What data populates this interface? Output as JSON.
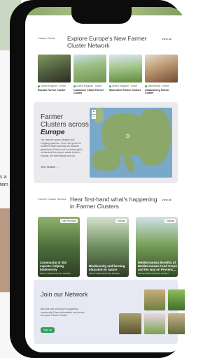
{
  "background_page": {
    "text_lines": [
      "s a",
      "tem"
    ]
  },
  "section_cluster_finder": {
    "label": "Cluster Finder",
    "title_line1": "Explore Europe's New Farmer",
    "title_line2": "Cluster Network",
    "view_all": "View all",
    "cards": [
      {
        "country": "United Kingdom",
        "status": "Active",
        "name": "Buckan Farmer Cluster"
      },
      {
        "country": "United Kingdom",
        "status": "Active",
        "name": "Cranborne Chase Farmer Cluster"
      },
      {
        "country": "United Kingdom",
        "status": "Active",
        "name": "Moorsbriet Farmer Cluster"
      },
      {
        "country": "Netherlands",
        "status": "Active",
        "name": "Zwaanshoeg Farmer Cluster"
      }
    ]
  },
  "section_map": {
    "title_line1": "Farmer",
    "title_line2": "Clusters across",
    "title_emph": "Europe",
    "description": "Our network spans climates and cropping systems - from vine groves in southern Spain and Italy via Austrian grasslands, French and Luxembourgish orchards all the way to arable fields in Estonia, the Netherlands and UK.",
    "link": "View network →",
    "controls": [
      "+",
      "−"
    ]
  },
  "section_stories": {
    "label": "Farmer Cluster Stories",
    "title_line1": "Hear first-hand what's happening",
    "title_line2": "in Farmer Clusters",
    "view_all": "View all",
    "stories": [
      {
        "tag": "Case Roundup",
        "title": "Community of 350 experts: helping biodiversity",
        "subtitle": "Farmer Network Farmer Clusters"
      },
      {
        "tag": "Editorial",
        "title": "Biodiversity and farming education in nature",
        "subtitle": "Farmer Network Farmer Clusters"
      },
      {
        "tag": "Editorial",
        "title": "Mediterranean Benefits of Mediterranean Food Crops and the way on Provenc...",
        "subtitle": "Farmer Network Farmer Clusters"
      }
    ]
  },
  "section_join": {
    "title": "Join our Network",
    "description": "Become part of Europe's supportive community! Share information and stories from your Farmer Cluster.",
    "button": "Sign up"
  }
}
